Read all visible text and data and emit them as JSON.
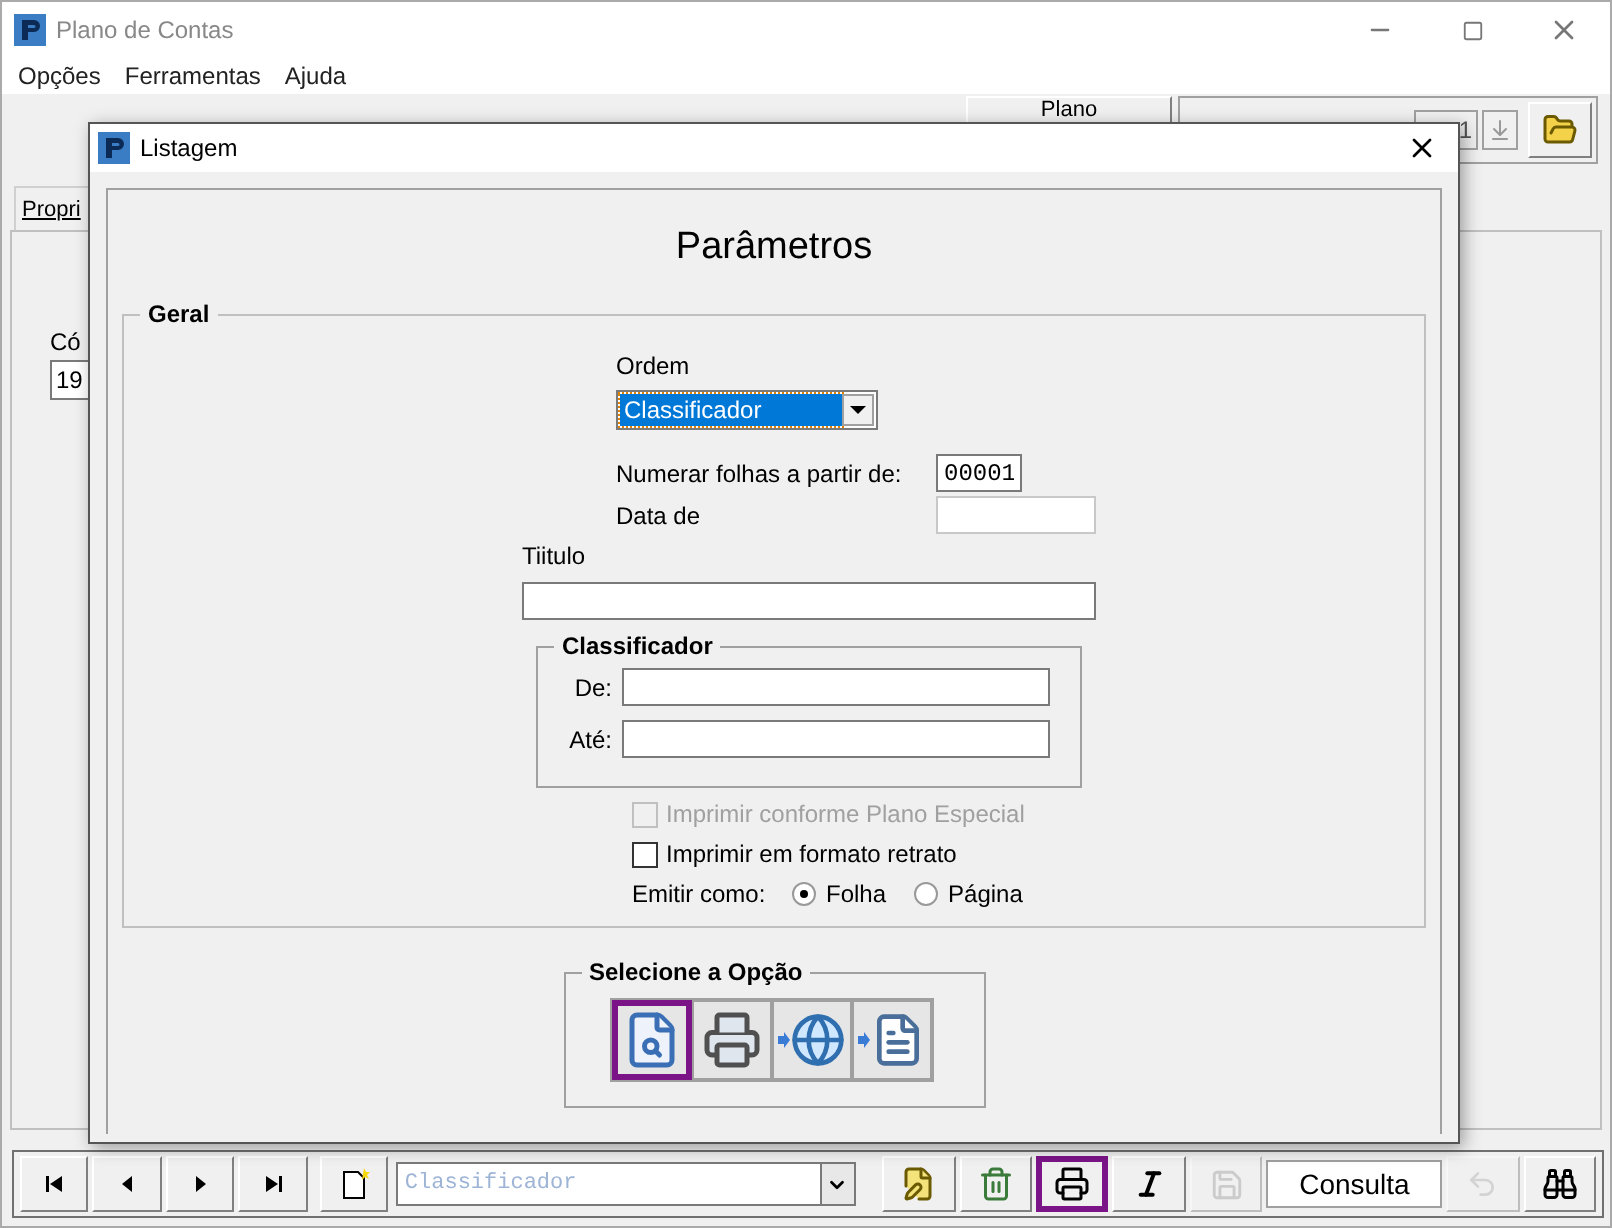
{
  "window": {
    "title": "Plano de Contas"
  },
  "menu": [
    "Opções",
    "Ferramentas",
    "Ajuda"
  ],
  "background": {
    "plano_button": "Plano",
    "counter": "1",
    "tab": "Propri",
    "code_label": "Có",
    "code_value": "19"
  },
  "dialog": {
    "title": "Listagem",
    "heading": "Parâmetros",
    "geral": {
      "legend": "Geral",
      "ordem_label": "Ordem",
      "ordem_value": "Classificador",
      "numerar_label": "Numerar folhas a partir de:",
      "numerar_value": "00001",
      "data_label": "Data de",
      "titulo_label": "Tiitulo"
    },
    "classificador": {
      "legend": "Classificador",
      "fields": [
        {
          "label": "De:"
        },
        {
          "label": "Até:"
        }
      ]
    },
    "checkboxes": [
      {
        "label": "Imprimir conforme Plano Especial",
        "checked": false,
        "disabled": true
      },
      {
        "label": "Imprimir em formato retrato",
        "checked": false,
        "disabled": false
      }
    ],
    "emitir": {
      "label": "Emitir como:",
      "options": [
        {
          "label": "Folha",
          "selected": true
        },
        {
          "label": "Página",
          "selected": false
        }
      ]
    },
    "opcao": {
      "legend": "Selecione a Opção",
      "buttons": [
        {
          "kind": "preview",
          "selected": true
        },
        {
          "kind": "print",
          "selected": false
        },
        {
          "kind": "web",
          "selected": false
        },
        {
          "kind": "file",
          "selected": false
        }
      ]
    }
  },
  "toolbar": {
    "left_buttons": [
      {
        "kind": "first",
        "selected": false,
        "disabled": false
      },
      {
        "kind": "prev",
        "selected": false,
        "disabled": false
      },
      {
        "kind": "next",
        "selected": false,
        "disabled": false
      },
      {
        "kind": "last",
        "selected": false,
        "disabled": false
      },
      {
        "kind": "new",
        "selected": false,
        "disabled": false
      }
    ],
    "combo": {
      "placeholder": "Classificador"
    },
    "right_buttons": [
      {
        "kind": "edit",
        "selected": false,
        "disabled": false
      },
      {
        "kind": "delete",
        "selected": false,
        "disabled": false
      },
      {
        "kind": "print",
        "selected": true,
        "disabled": false
      },
      {
        "kind": "italic",
        "selected": false,
        "disabled": false
      },
      {
        "kind": "save",
        "selected": false,
        "disabled": true
      }
    ],
    "status": "Consulta",
    "end_buttons": [
      {
        "kind": "undo",
        "selected": false,
        "disabled": true
      },
      {
        "kind": "find",
        "selected": false,
        "disabled": false
      }
    ]
  }
}
